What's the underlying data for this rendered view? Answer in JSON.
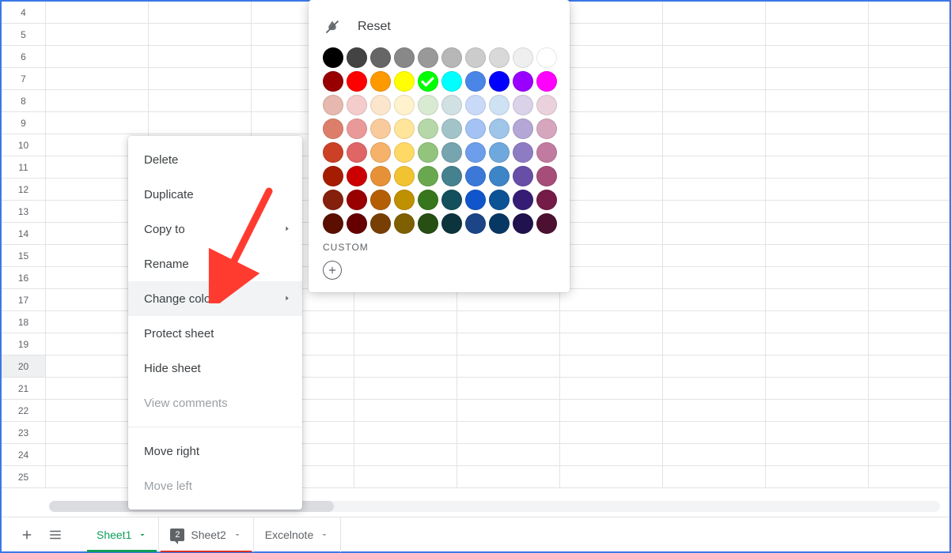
{
  "row_headers": [
    "4",
    "5",
    "6",
    "7",
    "8",
    "9",
    "10",
    "11",
    "12",
    "13",
    "14",
    "15",
    "16",
    "17",
    "18",
    "19",
    "20",
    "21",
    "22",
    "23",
    "24",
    "25"
  ],
  "selected_row": "20",
  "sheet_bar": {
    "tabs": [
      {
        "label": "Sheet1",
        "active": true
      },
      {
        "label": "Sheet2",
        "comment_count": "2"
      },
      {
        "label": "Excelnote"
      }
    ]
  },
  "context_menu": {
    "items": [
      {
        "key": "delete",
        "label": "Delete"
      },
      {
        "key": "duplicate",
        "label": "Duplicate"
      },
      {
        "key": "copy_to",
        "label": "Copy to",
        "submenu": true
      },
      {
        "key": "rename",
        "label": "Rename"
      },
      {
        "key": "change_color",
        "label": "Change color",
        "submenu": true,
        "hovered": true
      },
      {
        "key": "protect",
        "label": "Protect sheet"
      },
      {
        "key": "hide",
        "label": "Hide sheet"
      },
      {
        "key": "view_comments",
        "label": "View comments",
        "disabled": true
      },
      {
        "key": "sep"
      },
      {
        "key": "move_right",
        "label": "Move right"
      },
      {
        "key": "move_left",
        "label": "Move left",
        "disabled": true
      }
    ]
  },
  "color_picker": {
    "reset_label": "Reset",
    "custom_label": "CUSTOM",
    "selected_color": "#00ff00",
    "rows": [
      [
        "#000000",
        "#434343",
        "#666666",
        "#888888",
        "#999999",
        "#b7b7b7",
        "#cccccc",
        "#d9d9d9",
        "#efefef",
        "#ffffff"
      ],
      [
        "#980000",
        "#ff0000",
        "#ff9900",
        "#ffff00",
        "#00ff00",
        "#00ffff",
        "#4a86e8",
        "#0000ff",
        "#9900ff",
        "#ff00ff"
      ],
      [
        "#e6b8af",
        "#f4cccc",
        "#fce5cd",
        "#fff2cc",
        "#d9ead3",
        "#d0e0e3",
        "#c9daf8",
        "#cfe2f3",
        "#d9d2e9",
        "#ead1dc"
      ],
      [
        "#dd7e6b",
        "#ea9999",
        "#f9cb9c",
        "#ffe599",
        "#b6d7a8",
        "#a2c4c9",
        "#a4c2f4",
        "#9fc5e8",
        "#b4a7d6",
        "#d5a6bd"
      ],
      [
        "#cc4125",
        "#e06666",
        "#f6b26b",
        "#ffd966",
        "#93c47d",
        "#76a5af",
        "#6d9eeb",
        "#6fa8dc",
        "#8e7cc3",
        "#c27ba0"
      ],
      [
        "#a61c00",
        "#cc0000",
        "#e69138",
        "#f1c232",
        "#6aa84f",
        "#45818e",
        "#3c78d8",
        "#3d85c6",
        "#674ea7",
        "#a64d79"
      ],
      [
        "#85200c",
        "#990000",
        "#b45f06",
        "#bf9000",
        "#38761d",
        "#134f5c",
        "#1155cc",
        "#0b5394",
        "#351c75",
        "#741b47"
      ],
      [
        "#5b0f00",
        "#660000",
        "#783f04",
        "#7f6000",
        "#274e13",
        "#0c343d",
        "#1c4587",
        "#073763",
        "#20124d",
        "#4c1130"
      ]
    ]
  }
}
